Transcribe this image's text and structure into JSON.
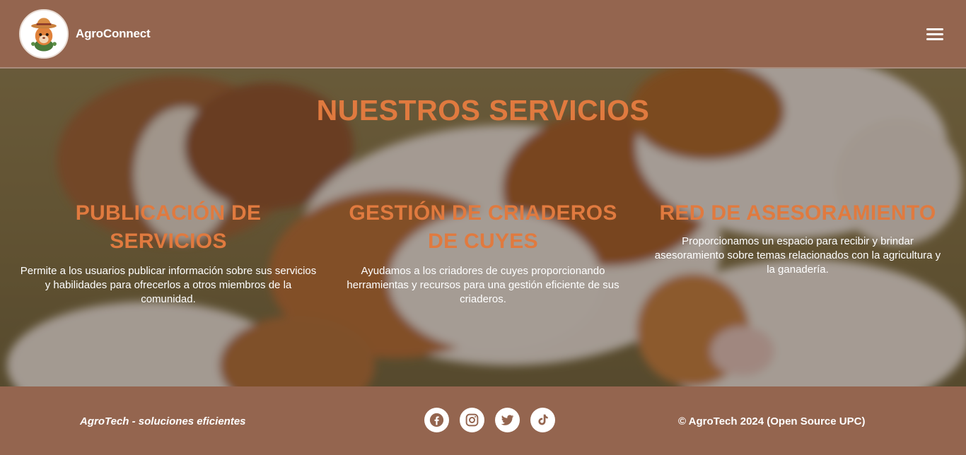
{
  "header": {
    "brand": "AgroConnect",
    "logo_icon": "guinea-pig-farmer-logo",
    "menu_icon": "hamburger-menu-icon"
  },
  "hero": {
    "title": "NUESTROS SERVICIOS",
    "background_image": "guinea-pigs-photo",
    "services": [
      {
        "title": "PUBLICACIÓN DE SERVICIOS",
        "description": "Permite a los usuarios publicar información sobre sus servicios y habilidades para ofrecerlos a otros miembros de la comunidad."
      },
      {
        "title": "GESTIÓN DE CRIADEROS DE CUYES",
        "description": "Ayudamos a los criadores de cuyes proporcionando herramientas y recursos para una gestión eficiente de sus criaderos."
      },
      {
        "title": "RED DE ASESORAMIENTO",
        "description": "Proporcionamos un espacio para recibir y brindar asesoramiento sobre temas relacionados con la agricultura y la ganadería."
      }
    ]
  },
  "footer": {
    "tagline": "AgroTech - soluciones eficientes",
    "copyright": "© AgroTech 2024 (Open Source UPC)",
    "social_icons": [
      "facebook-icon",
      "instagram-icon",
      "twitter-icon",
      "tiktok-icon"
    ]
  },
  "colors": {
    "brown": "#94654f",
    "accent_orange": "#e07a3f",
    "white": "#ffffff"
  }
}
